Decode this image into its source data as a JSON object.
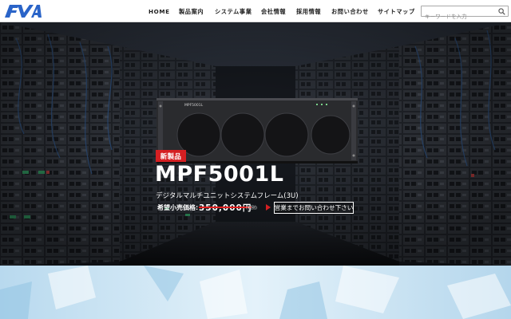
{
  "header": {
    "logo_text": "FVA",
    "nav": [
      {
        "label": "HOME"
      },
      {
        "label": "製品案内"
      },
      {
        "label": "システム事業"
      },
      {
        "label": "会社情報"
      },
      {
        "label": "採用情報"
      },
      {
        "label": "お問い合わせ"
      },
      {
        "label": "サイトマップ"
      }
    ],
    "search": {
      "placeholder": "キーワードを入力",
      "value": ""
    }
  },
  "hero": {
    "product_plate": "MPF5001L",
    "badge": "新製品",
    "model": "MPF5001L",
    "subtitle": "デジタルマルチユニットシステムフレーム(3U)",
    "price_label": "希望小売価格:",
    "price_value": "350,000円",
    "price_tax": "(税別)",
    "contact_button": "営業までお問い合わせ下さい"
  },
  "colors": {
    "accent": "#d51f22",
    "logo_blue": "#2a64c8",
    "hero_dark": "#1a1d24"
  }
}
